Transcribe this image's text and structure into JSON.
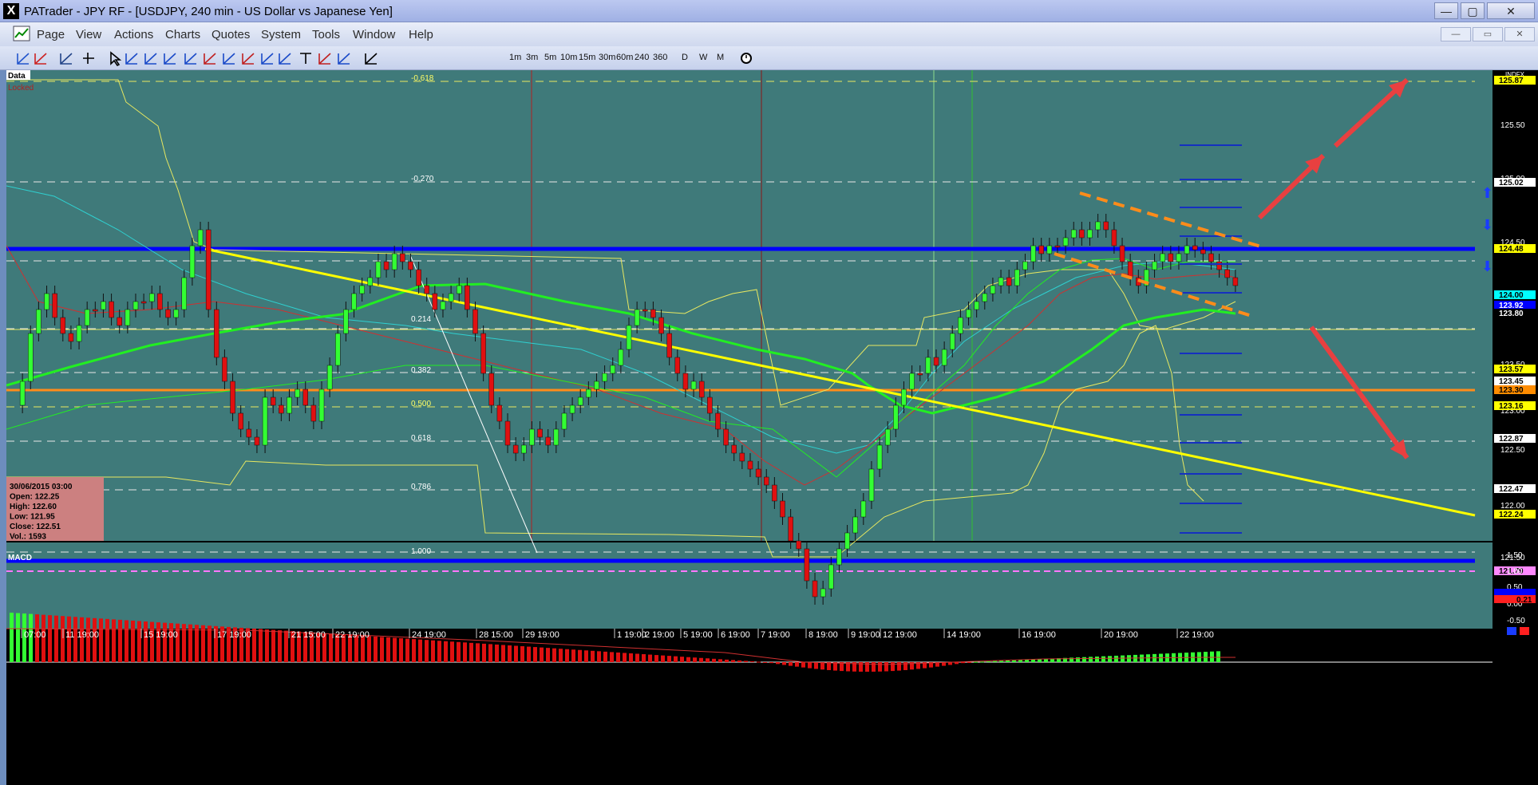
{
  "window": {
    "title": "PATrader - JPY RF - [USDJPY, 240 min - US Dollar vs Japanese Yen]",
    "icon_glyph": "X",
    "minimize": "—",
    "maximize": "▢",
    "close": "✕"
  },
  "menu": [
    "Page",
    "View",
    "Actions",
    "Charts",
    "Quotes",
    "System",
    "Tools",
    "Window",
    "Help"
  ],
  "mdi": {
    "minimize": "—",
    "restore": "▭",
    "close": "✕"
  },
  "timeframes": [
    "1m",
    "3m",
    "5m",
    "10m",
    "15m",
    "30m",
    "60m",
    "240",
    "360",
    "D",
    "W",
    "M"
  ],
  "chart": {
    "data_tag": "Data",
    "locked_label": "Locked",
    "indfx_tag": "INDFX",
    "fib_labels": [
      "-0.618",
      "-0.270",
      "0.214",
      "0.382",
      "0.500",
      "0.618",
      "0.786",
      "1.000"
    ],
    "price_axis": [
      "125.50",
      "125.00",
      "124.50",
      "124.00",
      "123.50",
      "123.00",
      "122.50",
      "122.00",
      "121.50"
    ],
    "price_tags": [
      {
        "v": "125.87",
        "bg": "#ffff00",
        "fg": "#000000"
      },
      {
        "v": "125.02",
        "bg": "#ffffff",
        "fg": "#000000"
      },
      {
        "v": "124.48",
        "bg": "#ffff00",
        "fg": "#000000"
      },
      {
        "v": "124.00",
        "bg": "#00ffff",
        "fg": "#000000"
      },
      {
        "v": "123.92",
        "bg": "#0000ff",
        "fg": "#ffffff"
      },
      {
        "v": "123.80",
        "bg": "#000000",
        "fg": "#ffffff"
      },
      {
        "v": "123.57",
        "bg": "#ffff00",
        "fg": "#000000"
      },
      {
        "v": "123.45",
        "bg": "#ffffff",
        "fg": "#000000"
      },
      {
        "v": "123.30",
        "bg": "#ff8c00",
        "fg": "#000000"
      },
      {
        "v": "123.16",
        "bg": "#ffff00",
        "fg": "#000000"
      },
      {
        "v": "122.87",
        "bg": "#ffffff",
        "fg": "#000000"
      },
      {
        "v": "122.47",
        "bg": "#ffffff",
        "fg": "#000000"
      },
      {
        "v": "122.24",
        "bg": "#ffff00",
        "fg": "#000000"
      },
      {
        "v": "121.79",
        "bg": "#ff88ff",
        "fg": "#000000"
      }
    ],
    "info_box": {
      "date": "30/06/2015 03:00",
      "open": "Open: 122.25",
      "high": "High: 122.60",
      "low": "Low: 121.95",
      "close": "Close: 122.51",
      "vol": "Vol.: 1593"
    },
    "macd": {
      "label": "MACD",
      "axis": [
        "1.50",
        "1.00",
        "0.50",
        "0.00",
        "-0.50"
      ],
      "value_tag": "0.21"
    },
    "time_axis": [
      "07:00",
      "11 19:00",
      "15 19:00",
      "17 19:00",
      "21 15:00",
      "22 19:00",
      "24 19:00",
      "28 15:00",
      "29 19:00",
      "1 19:00",
      "2 19:00",
      "5 19:00",
      "6 19:00",
      "7 19:00",
      "8 19:00",
      "9 19:00",
      "12 19:00",
      "14 19:00",
      "16 19:00",
      "20 19:00",
      "22 19:00"
    ]
  },
  "colors": {
    "chart_bg": "#3f7a7a",
    "bull": "#33ff33",
    "bear": "#e01010",
    "support_line": "#0000ff",
    "trendline": "#ffff00",
    "channel": "#ff8c1a",
    "arrow": "#e84040"
  }
}
